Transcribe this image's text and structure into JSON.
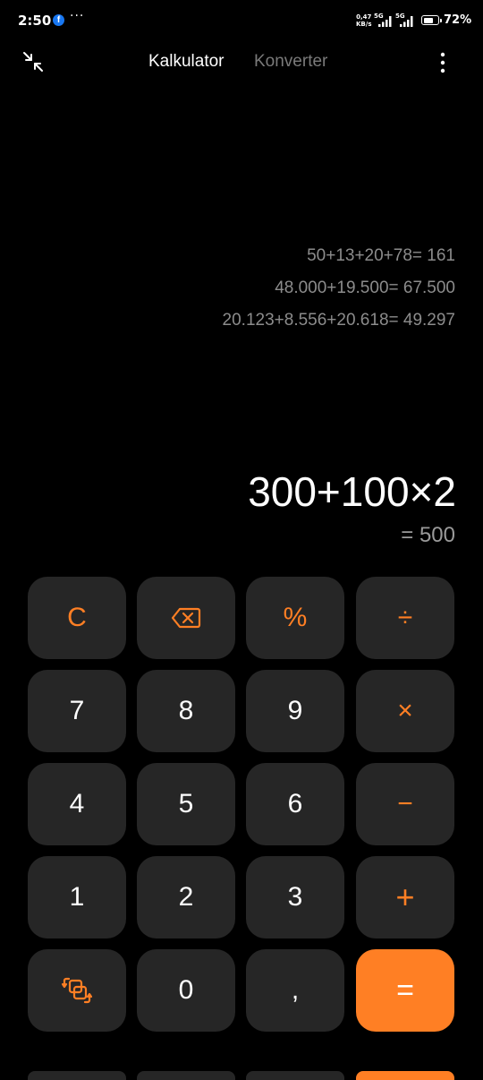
{
  "status_bar": {
    "time": "2:50",
    "facebook_glyph": "f",
    "more_notifications": "···",
    "net_speed_value": "0,47",
    "net_speed_unit": "KB/s",
    "signal_1_tag": "5G",
    "signal_2_tag": "5G",
    "battery_percent": "72%",
    "battery_level": 0.72
  },
  "header": {
    "tabs": [
      {
        "label": "Kalkulator",
        "active": true
      },
      {
        "label": "Konverter",
        "active": false
      }
    ],
    "minimize_icon": "minimize-arrows-icon",
    "menu_icon": "more-vertical-icon"
  },
  "history": [
    "50+13+20+78= 161",
    "48.000+19.500= 67.500",
    "20.123+8.556+20.618= 49.297"
  ],
  "display": {
    "expression": "300+100×2",
    "result": "= 500"
  },
  "keypad": {
    "keys": [
      {
        "label": "C"
      },
      {
        "label": "",
        "icon": "backspace-icon"
      },
      {
        "label": "%"
      },
      {
        "label": "÷"
      },
      {
        "label": "7"
      },
      {
        "label": "8"
      },
      {
        "label": "9"
      },
      {
        "label": "×"
      },
      {
        "label": "4"
      },
      {
        "label": "5"
      },
      {
        "label": "6"
      },
      {
        "label": "−"
      },
      {
        "label": "1"
      },
      {
        "label": "2"
      },
      {
        "label": "3"
      },
      {
        "label": "+"
      },
      {
        "label": "",
        "icon": "swap-mode-icon"
      },
      {
        "label": "0"
      },
      {
        "label": ","
      },
      {
        "label": "="
      }
    ]
  },
  "colors": {
    "accent": "#ff7f24",
    "key_background": "#262626",
    "background": "#000000",
    "secondary_text": "#8c8c8c",
    "inactive_tab": "#7a7a7a"
  }
}
